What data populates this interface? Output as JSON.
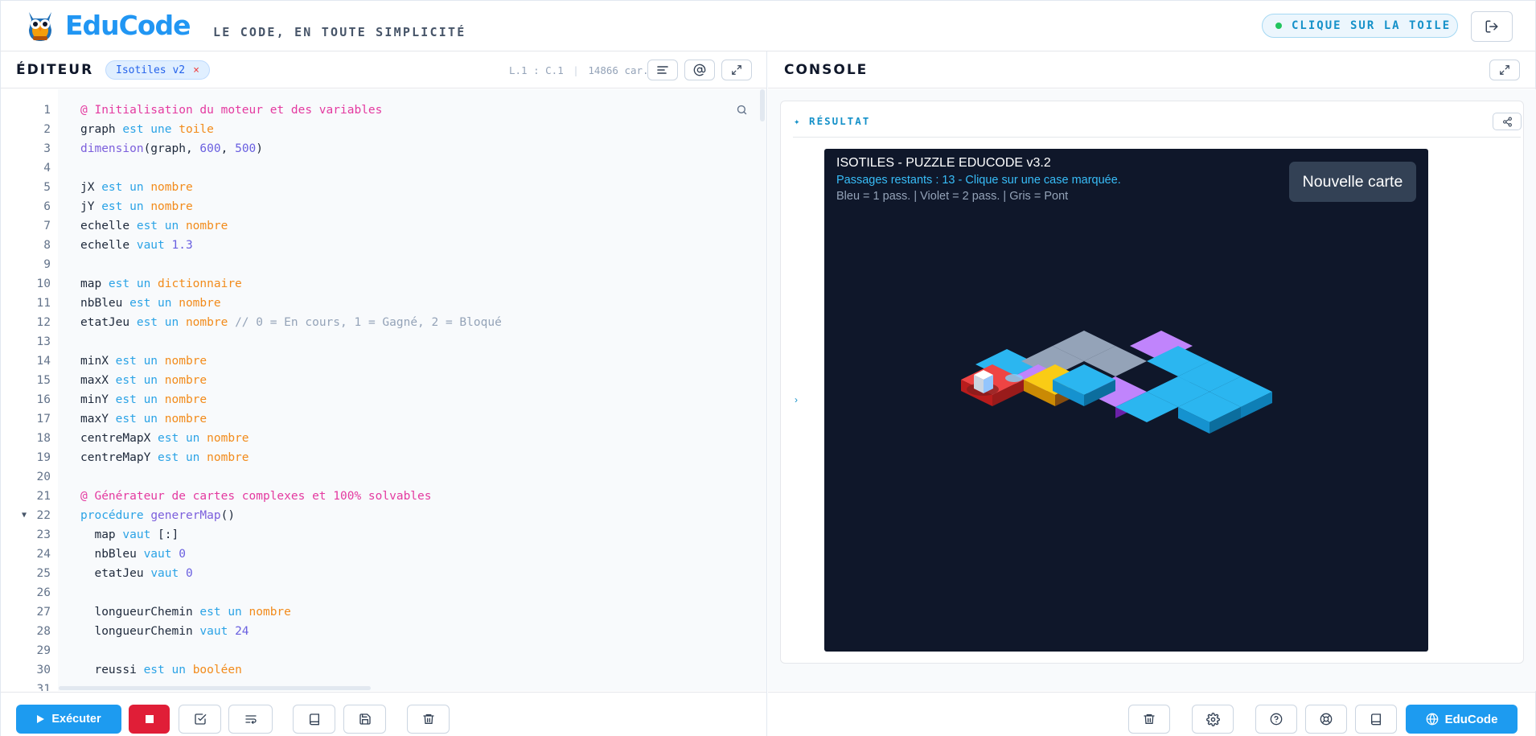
{
  "header": {
    "brand": "EduCode",
    "tagline": "LE CODE, EN TOUTE SIMPLICITÉ",
    "status_pill": "CLIQUE SUR LA TOILE",
    "logo_icon": "owl-logo-icon",
    "logout_icon": "logout-icon"
  },
  "editor": {
    "title": "ÉDITEUR",
    "file_name": "Isotiles v2",
    "file_close": "×",
    "cursor": "L.1 : C.1",
    "separator": "|",
    "char_count": "14866 car.",
    "icons": [
      "format-lines-icon",
      "at-sign-icon",
      "expand-icon",
      "search-icon"
    ],
    "lines": [
      {
        "n": "1",
        "t": [
          [
            "com",
            "@ Initialisation du moteur et des variables"
          ]
        ]
      },
      {
        "n": "2",
        "t": [
          [
            "plain",
            "graph "
          ],
          [
            "kw",
            "est une "
          ],
          [
            "ty",
            "toile"
          ]
        ]
      },
      {
        "n": "3",
        "t": [
          [
            "fn",
            "dimension"
          ],
          [
            "plain",
            "(graph, "
          ],
          [
            "num",
            "600"
          ],
          [
            "plain",
            ", "
          ],
          [
            "num",
            "500"
          ],
          [
            "plain",
            ")"
          ]
        ]
      },
      {
        "n": "4",
        "t": []
      },
      {
        "n": "5",
        "t": [
          [
            "plain",
            "jX "
          ],
          [
            "kw",
            "est un "
          ],
          [
            "ty",
            "nombre"
          ]
        ]
      },
      {
        "n": "6",
        "t": [
          [
            "plain",
            "jY "
          ],
          [
            "kw",
            "est un "
          ],
          [
            "ty",
            "nombre"
          ]
        ]
      },
      {
        "n": "7",
        "t": [
          [
            "plain",
            "echelle "
          ],
          [
            "kw",
            "est un "
          ],
          [
            "ty",
            "nombre"
          ]
        ]
      },
      {
        "n": "8",
        "t": [
          [
            "plain",
            "echelle "
          ],
          [
            "kw",
            "vaut "
          ],
          [
            "num",
            "1.3"
          ]
        ]
      },
      {
        "n": "9",
        "t": []
      },
      {
        "n": "10",
        "t": [
          [
            "plain",
            "map "
          ],
          [
            "kw",
            "est un "
          ],
          [
            "ty",
            "dictionnaire"
          ]
        ]
      },
      {
        "n": "11",
        "t": [
          [
            "plain",
            "nbBleu "
          ],
          [
            "kw",
            "est un "
          ],
          [
            "ty",
            "nombre"
          ]
        ]
      },
      {
        "n": "12",
        "t": [
          [
            "plain",
            "etatJeu "
          ],
          [
            "kw",
            "est un "
          ],
          [
            "ty",
            "nombre"
          ],
          [
            "cm",
            " // 0 = En cours, 1 = Gagné, 2 = Bloqué"
          ]
        ]
      },
      {
        "n": "13",
        "t": []
      },
      {
        "n": "14",
        "t": [
          [
            "plain",
            "minX "
          ],
          [
            "kw",
            "est un "
          ],
          [
            "ty",
            "nombre"
          ]
        ]
      },
      {
        "n": "15",
        "t": [
          [
            "plain",
            "maxX "
          ],
          [
            "kw",
            "est un "
          ],
          [
            "ty",
            "nombre"
          ]
        ]
      },
      {
        "n": "16",
        "t": [
          [
            "plain",
            "minY "
          ],
          [
            "kw",
            "est un "
          ],
          [
            "ty",
            "nombre"
          ]
        ]
      },
      {
        "n": "17",
        "t": [
          [
            "plain",
            "maxY "
          ],
          [
            "kw",
            "est un "
          ],
          [
            "ty",
            "nombre"
          ]
        ]
      },
      {
        "n": "18",
        "t": [
          [
            "plain",
            "centreMapX "
          ],
          [
            "kw",
            "est un "
          ],
          [
            "ty",
            "nombre"
          ]
        ]
      },
      {
        "n": "19",
        "t": [
          [
            "plain",
            "centreMapY "
          ],
          [
            "kw",
            "est un "
          ],
          [
            "ty",
            "nombre"
          ]
        ]
      },
      {
        "n": "20",
        "t": []
      },
      {
        "n": "21",
        "t": [
          [
            "com",
            "@ Générateur de cartes complexes et 100% solvables"
          ]
        ]
      },
      {
        "n": "22",
        "fold": "▼",
        "t": [
          [
            "kw",
            "procédure "
          ],
          [
            "fn",
            "genererMap"
          ],
          [
            "plain",
            "()"
          ]
        ]
      },
      {
        "n": "23",
        "t": [
          [
            "plain",
            "  map "
          ],
          [
            "kw",
            "vaut "
          ],
          [
            "plain",
            "[:]"
          ]
        ]
      },
      {
        "n": "24",
        "t": [
          [
            "plain",
            "  nbBleu "
          ],
          [
            "kw",
            "vaut "
          ],
          [
            "num",
            "0"
          ]
        ]
      },
      {
        "n": "25",
        "t": [
          [
            "plain",
            "  etatJeu "
          ],
          [
            "kw",
            "vaut "
          ],
          [
            "num",
            "0"
          ]
        ]
      },
      {
        "n": "26",
        "t": []
      },
      {
        "n": "27",
        "t": [
          [
            "plain",
            "  longueurChemin "
          ],
          [
            "kw",
            "est un "
          ],
          [
            "ty",
            "nombre"
          ]
        ]
      },
      {
        "n": "28",
        "t": [
          [
            "plain",
            "  longueurChemin "
          ],
          [
            "kw",
            "vaut "
          ],
          [
            "num",
            "24"
          ]
        ]
      },
      {
        "n": "29",
        "t": []
      },
      {
        "n": "30",
        "t": [
          [
            "plain",
            "  reussi "
          ],
          [
            "kw",
            "est un "
          ],
          [
            "ty",
            "booléen"
          ]
        ]
      },
      {
        "n": "31",
        "t": []
      }
    ]
  },
  "toolbar_left": {
    "run_label": "Exécuter",
    "icons": [
      "play-icon",
      "stop-icon",
      "check-square-icon",
      "wrap-text-icon",
      "book-icon",
      "save-icon",
      "trash-icon"
    ]
  },
  "console": {
    "title": "CONSOLE",
    "result_label": "✦ RÉSULTAT",
    "expand_chevron": "›",
    "icons": [
      "expand-icon",
      "share-icon"
    ]
  },
  "game": {
    "title": "ISOTILES - PUZZLE EDUCODE v3.2",
    "info": "Passages restants : 13 - Clique sur une case marquée.",
    "legend": "Bleu = 1 pass. | Violet = 2 pass. | Gris = Pont",
    "new_map_button": "Nouvelle carte",
    "colors": {
      "blue": "#2bb6f0",
      "violet": "#c084fc",
      "gray": "#94a3b8",
      "yellow": "#facc15",
      "red": "#ef4444",
      "background": "#0f172a"
    }
  },
  "toolbar_right": {
    "educode_label": "EduCode",
    "icons": [
      "trash-icon",
      "gear-icon",
      "help-circle-icon",
      "lifebuoy-icon",
      "book-icon",
      "globe-icon"
    ]
  },
  "colors": {
    "accent": "#1d9bf0",
    "stop": "#e01e37"
  }
}
